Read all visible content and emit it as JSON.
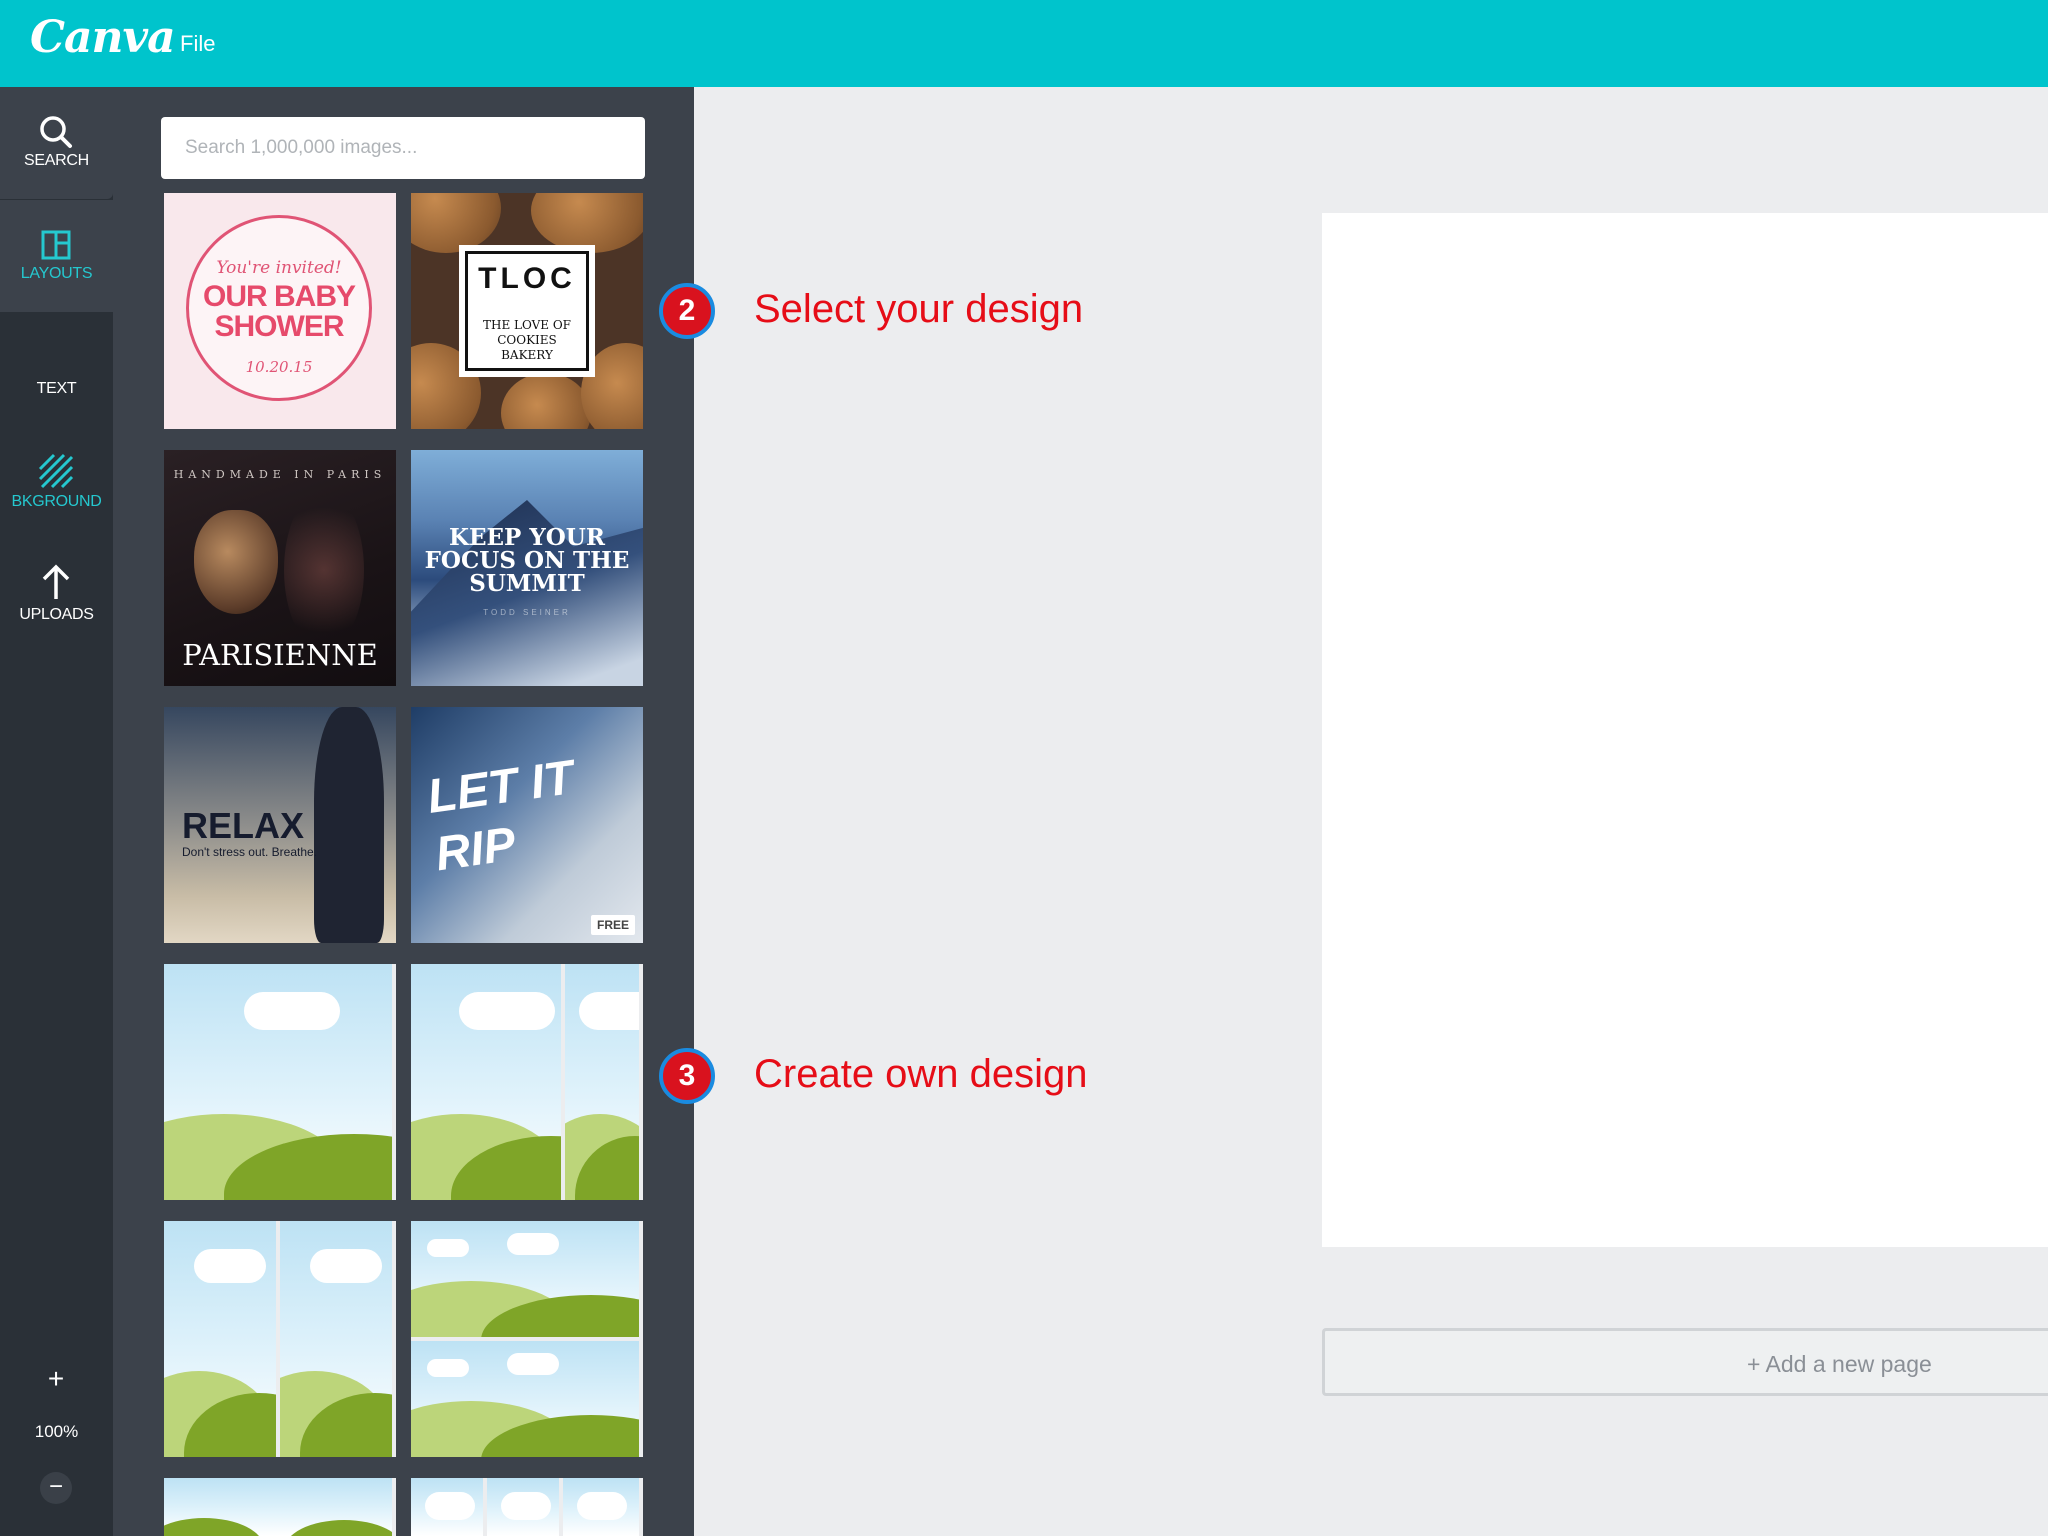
{
  "app": {
    "logo": "Canva",
    "menu_file": "File"
  },
  "rail": {
    "search": "SEARCH",
    "layouts": "LAYOUTS",
    "text": "TEXT",
    "background": "BKGROUND",
    "uploads": "UPLOADS",
    "zoom_in": "+",
    "zoom_level": "100%",
    "zoom_out": "−"
  },
  "panel": {
    "search_placeholder": "Search 1,000,000 images...",
    "templates": {
      "baby": {
        "invite": "You're invited!",
        "title": "OUR BABY SHOWER",
        "date": "10.20.15"
      },
      "cookie": {
        "title": "TLOC",
        "subtitle": "THE LOVE OF COOKIES BAKERY"
      },
      "paris": {
        "top": "HANDMADE IN PARIS",
        "word": "PARISIENNE"
      },
      "summit": {
        "title": "KEEP YOUR FOCUS ON THE SUMMIT",
        "signature": "TODD SEINER"
      },
      "relax": {
        "title": "RELAX",
        "subtitle": "Don't stress out. Breathe."
      },
      "rip": {
        "title": "LET IT RIP",
        "badge": "FREE"
      }
    }
  },
  "callouts": [
    {
      "number": "2",
      "text": "Select your design"
    },
    {
      "number": "3",
      "text": "Create own design"
    }
  ],
  "canvas": {
    "add_page": "+ Add a new page"
  },
  "colors": {
    "topbar": "#00c4cc",
    "rail": "#2a3037",
    "panel": "#3c424b",
    "accent_teal": "#25c8cf",
    "callout_red": "#e60d17"
  }
}
